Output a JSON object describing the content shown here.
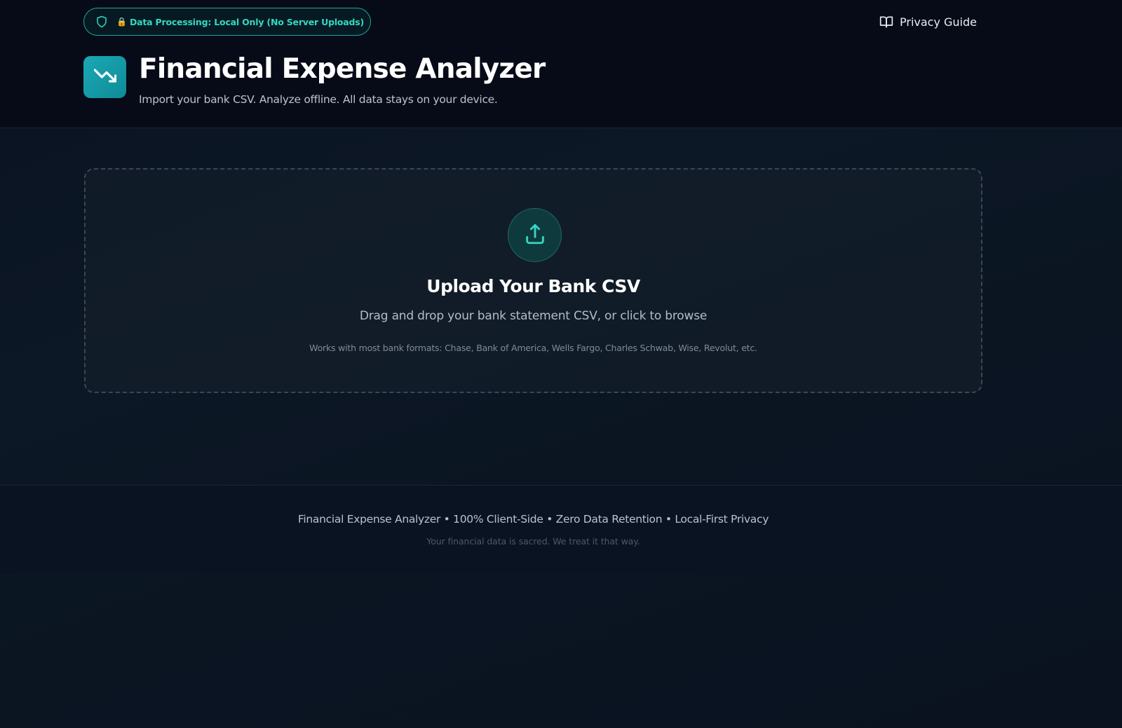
{
  "header": {
    "badge": {
      "text": "Data Processing: Local Only (No Server Uploads)",
      "shield_icon": "shield-icon",
      "lock_icon": "lock-icon",
      "color": "#34d8c2"
    },
    "privacy_link": {
      "label": "Privacy Guide",
      "icon": "book-open-icon"
    },
    "logo_icon": "trending-down-icon",
    "title": "Financial Expense Analyzer",
    "subtitle": "Import your bank CSV. Analyze offline. All data stays on your device."
  },
  "upload": {
    "icon": "upload-icon",
    "title": "Upload Your Bank CSV",
    "description": "Drag and drop your bank statement CSV, or click to browse",
    "formats": "Works with most bank formats: Chase, Bank of America, Wells Fargo, Charles Schwab, Wise, Revolut, etc."
  },
  "footer": {
    "main": "Financial Expense Analyzer • 100% Client-Side • Zero Data Retention • Local-First Privacy",
    "sub": "Your financial data is sacred. We treat it that way."
  },
  "colors": {
    "accent": "#1ba8b4",
    "badge_border": "#1aa89a",
    "background": "#0a1220"
  }
}
